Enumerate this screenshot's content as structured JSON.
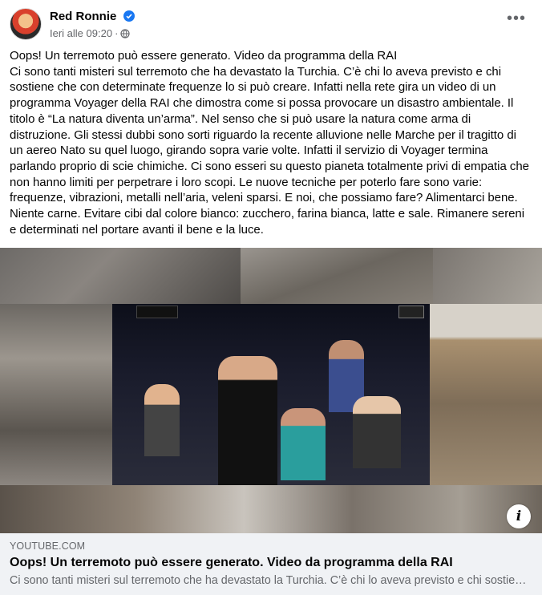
{
  "post": {
    "author": "Red Ronnie",
    "timestamp": "Ieri alle 09:20",
    "separator": "·",
    "audience_icon": "globe-icon",
    "verified_icon": "verified-badge-icon",
    "more_icon": "more-options-icon",
    "more_label": "•••",
    "text_lines": [
      "Oops! Un terremoto può essere generato. Video da programma della RAI",
      "Ci sono tanti misteri sul terremoto che ha devastato la Turchia. C’è chi lo aveva previsto e chi sostiene che con determinate frequenze lo si può creare. Infatti nella rete gira un video di un programma Voyager della RAI che dimostra come si possa provocare un disastro ambientale. Il titolo è “La natura diventa un’arma”. Nel senso che si può usare la natura come arma di distruzione. Gli stessi dubbi sono sorti riguardo la recente alluvione nelle Marche per il tragitto di un aereo Nato su quel luogo, girando sopra varie volte. Infatti il servizio di Voyager termina parlando proprio di scie chimiche. Ci sono esseri su questo pianeta totalmente privi di empatia che non hanno limiti per perpetrare i loro scopi. Le nuove tecniche per poterlo fare sono varie: frequenze, vibrazioni, metalli nell’aria, veleni sparsi. E noi, che possiamo fare? Alimentarci bene. Niente carne. Evitare cibi dal colore bianco: zucchero, farina bianca, latte e sale. Rimanere sereni e determinati nel portare avanti il bene e la luce."
    ]
  },
  "image": {
    "info_label": "i",
    "info_icon": "info-icon"
  },
  "link_preview": {
    "domain": "YOUTUBE.COM",
    "title": "Oops! Un terremoto può essere generato. Video da programma della RAI",
    "description": "Ci sono tanti misteri sul terremoto che ha devastato la Turchia. C’è chi lo aveva previsto e chi sostiene che con determinate frequenze lo si può creare."
  },
  "colors": {
    "verified_blue": "#1877f2",
    "secondary_text": "#65676b",
    "preview_bg": "#f0f2f5"
  }
}
